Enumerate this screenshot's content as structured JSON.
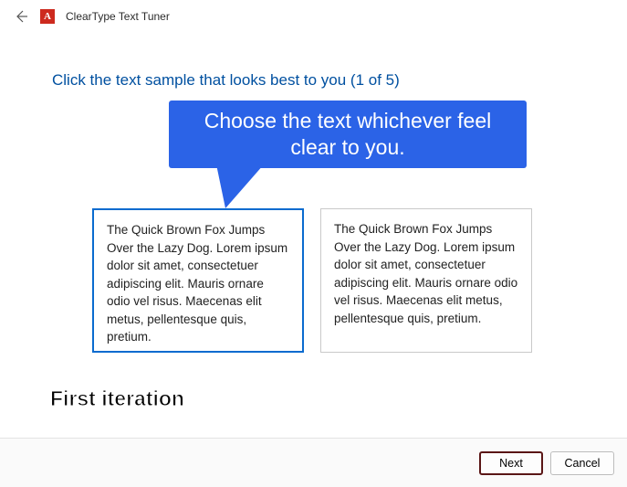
{
  "window": {
    "title": "ClearType Text Tuner",
    "app_icon_letter": "A"
  },
  "instruction": "Click the text sample that looks best to you (1 of 5)",
  "callout": {
    "line1": "Choose the text whichever feel",
    "line2": "clear to you."
  },
  "samples": {
    "left": "The Quick Brown Fox Jumps Over the Lazy Dog. Lorem ipsum dolor sit amet, consectetuer adipiscing elit. Mauris ornare odio vel risus. Maecenas elit metus, pellentesque quis, pretium.",
    "right": "The Quick Brown Fox Jumps Over the Lazy Dog. Lorem ipsum dolor sit amet, consectetuer adipiscing elit. Mauris ornare odio vel risus. Maecenas elit metus, pellentesque quis, pretium."
  },
  "iteration_label": "First iteration",
  "footer": {
    "next": "Next",
    "cancel": "Cancel"
  }
}
